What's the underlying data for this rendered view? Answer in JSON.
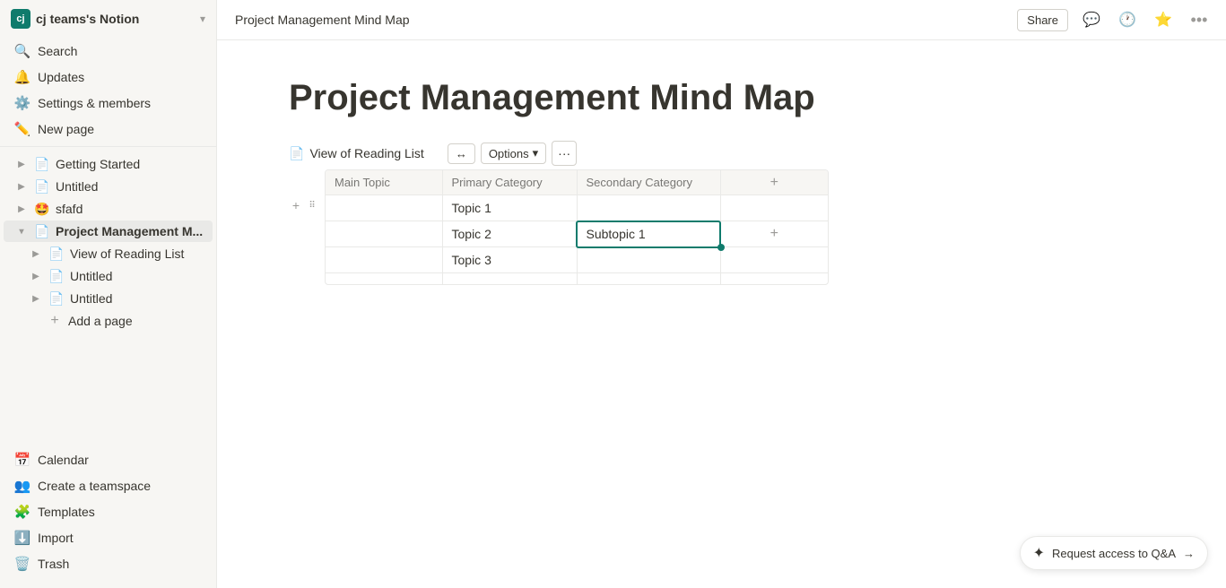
{
  "workspace": {
    "avatar_initials": "cj",
    "name": "cj teams's Notion",
    "avatar_bg": "#0f7b6c"
  },
  "sidebar": {
    "actions": [
      {
        "id": "search",
        "icon": "🔍",
        "label": "Search"
      },
      {
        "id": "updates",
        "icon": "🔔",
        "label": "Updates"
      },
      {
        "id": "settings",
        "icon": "⚙️",
        "label": "Settings & members"
      },
      {
        "id": "new-page",
        "icon": "✏️",
        "label": "New page"
      }
    ],
    "nav_items": [
      {
        "id": "getting-started",
        "icon": "📄",
        "label": "Getting Started",
        "indent": 0,
        "expanded": false
      },
      {
        "id": "untitled-1",
        "icon": "📄",
        "label": "Untitled",
        "indent": 0,
        "expanded": false
      },
      {
        "id": "sfafd",
        "icon": "🤩",
        "label": "sfafd",
        "indent": 0,
        "expanded": false
      },
      {
        "id": "project-mgmt",
        "icon": "📄",
        "label": "Project Management M...",
        "indent": 0,
        "expanded": true,
        "active": true
      },
      {
        "id": "view-reading-list",
        "icon": "📄",
        "label": "View of Reading List",
        "indent": 1,
        "expanded": false
      },
      {
        "id": "untitled-2",
        "icon": "📄",
        "label": "Untitled",
        "indent": 1,
        "expanded": false
      },
      {
        "id": "untitled-3",
        "icon": "📄",
        "label": "Untitled",
        "indent": 1,
        "expanded": false
      }
    ],
    "add_page_label": "Add a page",
    "bottom_items": [
      {
        "id": "calendar",
        "icon": "📅",
        "label": "Calendar"
      },
      {
        "id": "create-teamspace",
        "icon": "👥",
        "label": "Create a teamspace"
      },
      {
        "id": "templates",
        "icon": "🧩",
        "label": "Templates"
      },
      {
        "id": "import",
        "icon": "⬇️",
        "label": "Import"
      },
      {
        "id": "trash",
        "icon": "🗑️",
        "label": "Trash"
      }
    ]
  },
  "topbar": {
    "page_title": "Project Management Mind Map",
    "share_label": "Share",
    "icons": [
      "💬",
      "🕐",
      "⭐",
      "•••"
    ]
  },
  "page": {
    "heading": "Project Management Mind Map",
    "db_view": {
      "view_icon": "📄",
      "view_label": "View of Reading List",
      "options_label": "Options",
      "resize_icon": "↔",
      "more_icon": "···"
    },
    "table": {
      "columns": [
        {
          "id": "main-topic",
          "label": "Main Topic"
        },
        {
          "id": "primary-category",
          "label": "Primary Category"
        },
        {
          "id": "secondary-category",
          "label": "Secondary Category"
        }
      ],
      "rows": [
        {
          "id": "row-1",
          "main_topic": "",
          "primary_category": "Topic 1",
          "secondary_category": ""
        },
        {
          "id": "row-2",
          "main_topic": "",
          "primary_category": "Topic 2",
          "secondary_category": "Subtopic 1",
          "editing": true
        },
        {
          "id": "row-3",
          "main_topic": "",
          "primary_category": "Topic 3",
          "secondary_category": ""
        },
        {
          "id": "row-4",
          "main_topic": "",
          "primary_category": "",
          "secondary_category": ""
        }
      ]
    }
  },
  "request_access": {
    "label": "Request access to Q&A",
    "arrow": "→"
  }
}
